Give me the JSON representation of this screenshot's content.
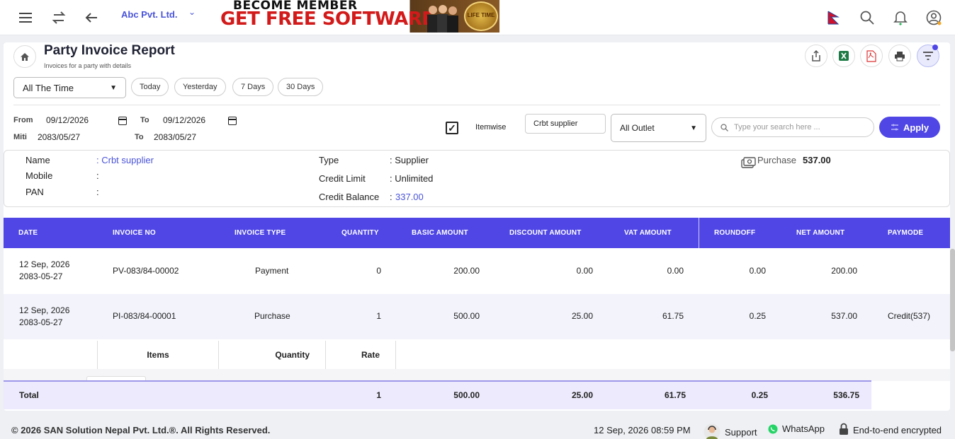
{
  "topbar": {
    "company": "Abc Pvt. Ltd.",
    "banner_line1": "BECOME MEMBER",
    "banner_line2": "GET FREE SOFTWARE",
    "banner_seal": "LIFE TIME",
    "icons": [
      "menu-icon",
      "swap-icon",
      "back-arrow-icon",
      "nepal-flag-icon",
      "search-icon",
      "bell-icon",
      "user-icon"
    ]
  },
  "header": {
    "title": "Party Invoice Report",
    "subtitle": "Invoices for a party with details"
  },
  "filters": {
    "period_select": "All The Time",
    "quick_ranges": [
      "Today",
      "Yesterday",
      "7 Days",
      "30 Days"
    ],
    "from_label": "From",
    "from_date": "09/12/2026",
    "to_label": "To",
    "to_date": "09/12/2026",
    "miti_label": "Miti",
    "miti_from": "2083/05/27",
    "miti_to_label": "To",
    "miti_to": "2083/05/27",
    "itemwise_label": "Itemwise",
    "itemwise_checked": true,
    "party_value": "Crbt supplier",
    "outlet_select": "All Outlet",
    "search_placeholder": "Type your search here ...",
    "apply_label": "Apply"
  },
  "party": {
    "name_label": "Name",
    "name_value": ": Crbt supplier",
    "mobile_label": "Mobile",
    "mobile_value": ":",
    "pan_label": "PAN",
    "pan_value": ":",
    "type_label": "Type",
    "type_value": ": Supplier",
    "credit_limit_label": "Credit Limit",
    "credit_limit_value": ": Unlimited",
    "credit_balance_label": "Credit Balance",
    "credit_balance_colon": ":",
    "credit_balance_value": "337.00",
    "purchase_label": "Purchase",
    "purchase_value": "537.00"
  },
  "table": {
    "columns": [
      "DATE",
      "INVOICE NO",
      "INVOICE TYPE",
      "QUANTITY",
      "BASIC AMOUNT",
      "DISCOUNT AMOUNT",
      "VAT AMOUNT",
      "ROUNDOFF",
      "NET AMOUNT",
      "PAYMODE"
    ],
    "rows": [
      {
        "date": "12 Sep, 2026",
        "miti": "2083-05-27",
        "invoice_no": "PV-083/84-00002",
        "invoice_type": "Payment",
        "quantity": "0",
        "basic": "200.00",
        "discount": "0.00",
        "vat": "0.00",
        "roundoff": "0.00",
        "net": "200.00",
        "paymode": ""
      },
      {
        "date": "12 Sep, 2026",
        "miti": "2083-05-27",
        "invoice_no": "PI-083/84-00001",
        "invoice_type": "Purchase",
        "quantity": "1",
        "basic": "500.00",
        "discount": "25.00",
        "vat": "61.75",
        "roundoff": "0.25",
        "net": "537.00",
        "paymode": "Credit(537)"
      }
    ],
    "items_header": [
      "Items",
      "Quantity",
      "Rate"
    ],
    "total": {
      "label": "Total",
      "quantity": "1",
      "basic": "500.00",
      "discount": "25.00",
      "vat": "61.75",
      "roundoff": "0.25",
      "net": "536.75"
    }
  },
  "footer": {
    "copyright": "© 2026  SAN Solution Nepal Pvt. Ltd.®. All Rights Reserved.",
    "datetime": "12 Sep, 2026 08:59 PM",
    "support": "Support",
    "whatsapp": "WhatsApp",
    "encrypted": "End-to-end encrypted"
  },
  "colors": {
    "accent": "#4f46e5",
    "link": "#4a54d8",
    "total_bg": "#eceafc"
  }
}
